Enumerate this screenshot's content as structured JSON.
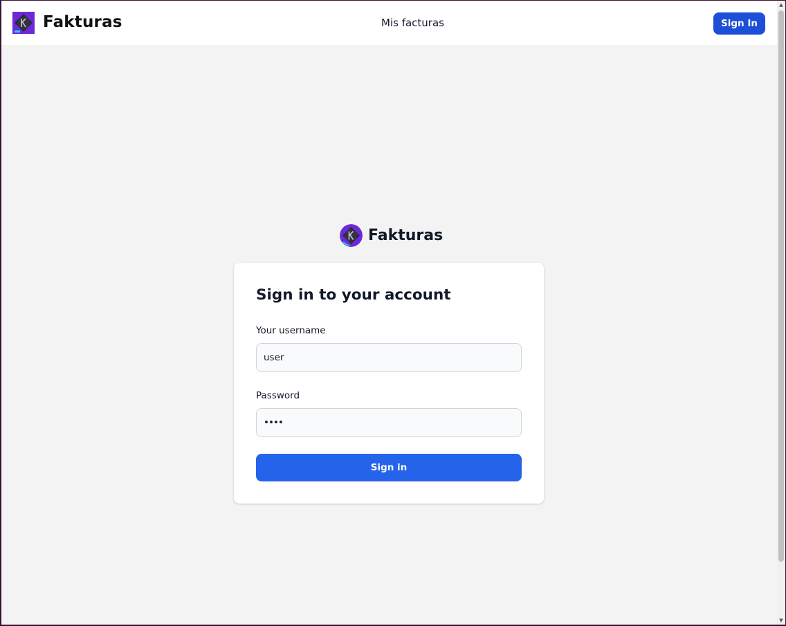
{
  "navbar": {
    "brand": "Fakturas",
    "link": "Mis facturas",
    "signin_label": "Sign In"
  },
  "login": {
    "brand": "Fakturas",
    "heading": "Sign in to your account",
    "username_label": "Your username",
    "username_value": "user",
    "password_label": "Password",
    "password_value": "••••",
    "submit_label": "Sign in"
  },
  "colors": {
    "primary": "#2563eb",
    "primary_dark": "#1d4ed8",
    "logo_purple": "#6d28d9",
    "page_bg": "#f3f3f3"
  },
  "icons": {
    "logo": "fakturas-k-logo-icon"
  }
}
